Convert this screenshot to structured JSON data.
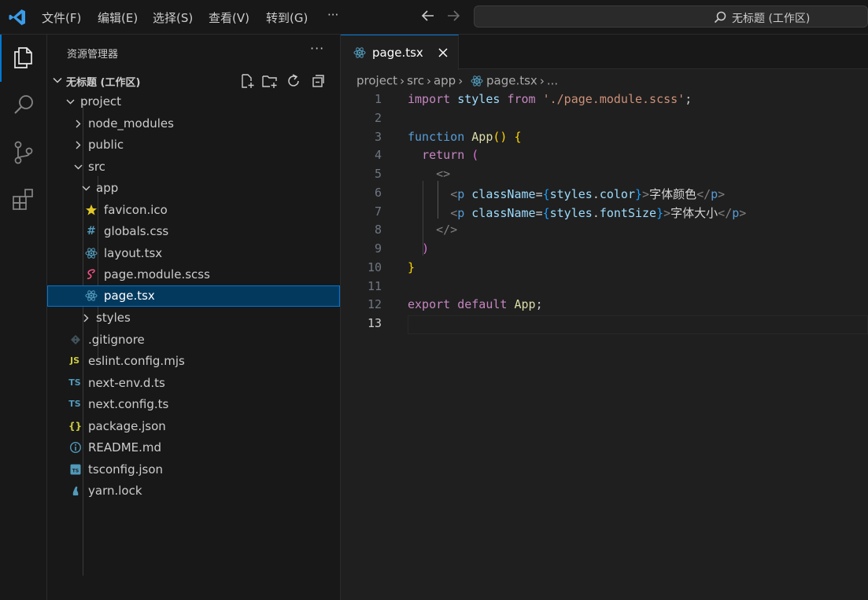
{
  "titlebar": {
    "menu": [
      "文件(F)",
      "编辑(E)",
      "选择(S)",
      "查看(V)",
      "转到(G)",
      "···"
    ],
    "command_center": "无标题 (工作区)"
  },
  "sidebar": {
    "title": "资源管理器",
    "more": "···",
    "workspace": "无标题 (工作区)",
    "tree": [
      {
        "label": "project",
        "kind": "folder-open"
      },
      {
        "label": "node_modules",
        "kind": "folder"
      },
      {
        "label": "public",
        "kind": "folder"
      },
      {
        "label": "src",
        "kind": "folder-open"
      },
      {
        "label": "app",
        "kind": "folder-open"
      },
      {
        "label": "favicon.ico",
        "kind": "star-icon"
      },
      {
        "label": "globals.css",
        "kind": "css-icon"
      },
      {
        "label": "layout.tsx",
        "kind": "react-icon"
      },
      {
        "label": "page.module.scss",
        "kind": "sass-icon"
      },
      {
        "label": "page.tsx",
        "kind": "react-icon"
      },
      {
        "label": "styles",
        "kind": "folder"
      },
      {
        "label": ".gitignore",
        "kind": "git-icon"
      },
      {
        "label": "eslint.config.mjs",
        "kind": "js-icon"
      },
      {
        "label": "next-env.d.ts",
        "kind": "ts-icon"
      },
      {
        "label": "next.config.ts",
        "kind": "ts-icon"
      },
      {
        "label": "package.json",
        "kind": "json-icon"
      },
      {
        "label": "README.md",
        "kind": "info-icon"
      },
      {
        "label": "tsconfig.json",
        "kind": "tsconfig-icon"
      },
      {
        "label": "yarn.lock",
        "kind": "yarn-icon"
      }
    ]
  },
  "editor": {
    "tab": {
      "label": "page.tsx"
    },
    "breadcrumb": [
      "project",
      "src",
      "app",
      "page.tsx",
      "..."
    ],
    "line_numbers": [
      "1",
      "2",
      "3",
      "4",
      "5",
      "6",
      "7",
      "8",
      "9",
      "10",
      "11",
      "12",
      "13"
    ],
    "code": {
      "l1": {
        "import": "import",
        "styles": "styles",
        "from": "from",
        "path": "'./page.module.scss'",
        "semi": ";"
      },
      "l3": {
        "function": "function",
        "name": "App",
        "parens": "()",
        "brace": "{"
      },
      "l4": {
        "return": "return",
        "paren": "("
      },
      "l5": {
        "frag_open": "<>"
      },
      "l6": {
        "lt": "<",
        "tag": "p",
        "attr": "className",
        "eq": "=",
        "ob": "{",
        "expr": "styles",
        "dot": ".",
        "prop": "color",
        "cb": "}",
        "gt": ">",
        "text": "字体颜色",
        "close": "</",
        "ctag": "p",
        "cgt": ">"
      },
      "l7": {
        "lt": "<",
        "tag": "p",
        "attr": "className",
        "eq": "=",
        "ob": "{",
        "expr": "styles",
        "dot": ".",
        "prop": "fontSize",
        "cb": "}",
        "gt": ">",
        "text": "字体大小",
        "close": "</",
        "ctag": "p",
        "cgt": ">"
      },
      "l8": {
        "frag_close": "</>"
      },
      "l9": {
        "paren": ")"
      },
      "l10": {
        "brace": "}"
      },
      "l12": {
        "export": "export",
        "default": "default",
        "name": "App",
        "semi": ";"
      }
    }
  }
}
